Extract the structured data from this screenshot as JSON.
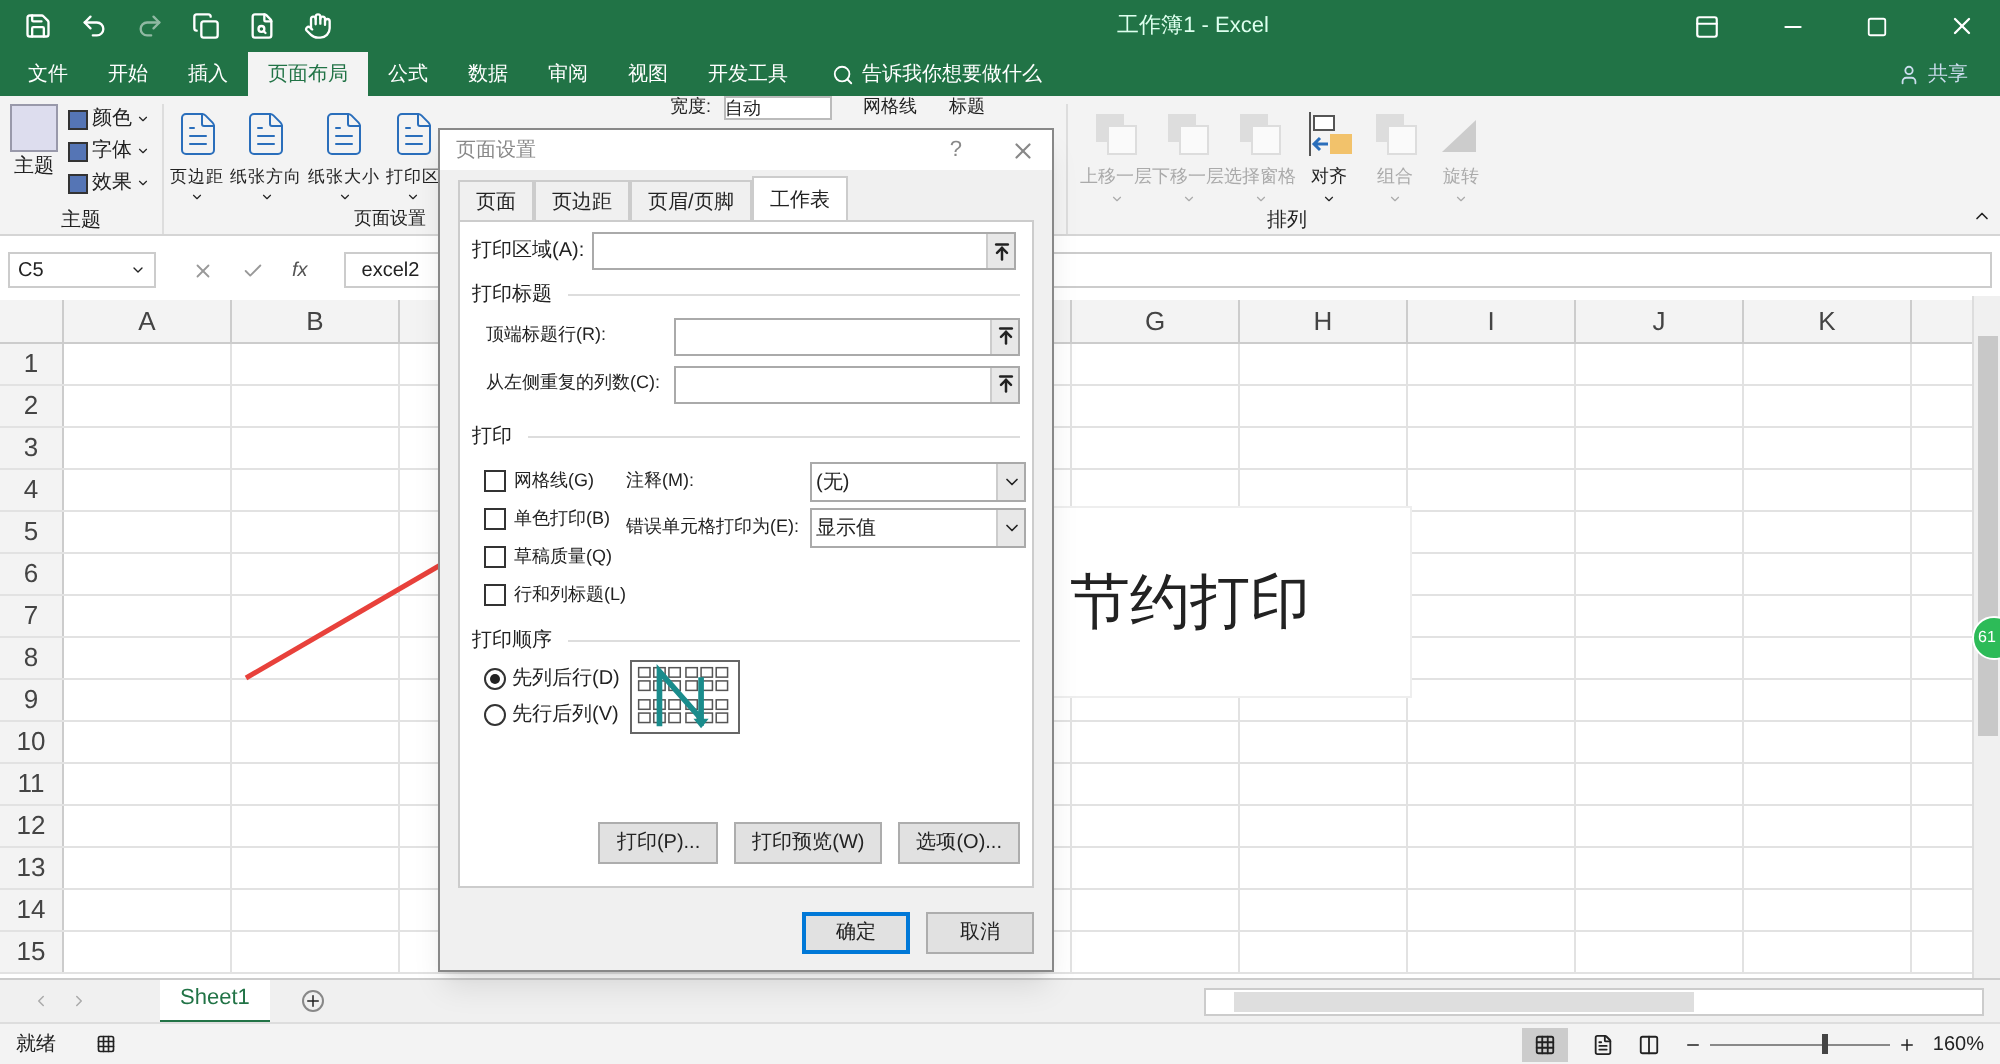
{
  "title_bar": {
    "title": "工作簿1  -  Excel"
  },
  "menu_tabs": [
    {
      "label": "文件",
      "selected": false
    },
    {
      "label": "开始",
      "selected": false
    },
    {
      "label": "插入",
      "selected": false
    },
    {
      "label": "页面布局",
      "selected": true
    },
    {
      "label": "公式",
      "selected": false
    },
    {
      "label": "数据",
      "selected": false
    },
    {
      "label": "审阅",
      "selected": false
    },
    {
      "label": "视图",
      "selected": false
    },
    {
      "label": "开发工具",
      "selected": false
    }
  ],
  "tell_me": "告诉我你想要做什么",
  "share": "共享",
  "ribbon": {
    "theme_group": {
      "label": "主题",
      "main": "主题",
      "items": [
        "颜色",
        "字体",
        "效果"
      ]
    },
    "page_setup_group": {
      "label": "页面设置",
      "items": [
        "页边距",
        "纸张方向",
        "纸张大小",
        "打印区"
      ]
    },
    "scale_group": {
      "width_label": "宽度:",
      "width_value": "自动"
    },
    "sheet_options": [
      "网格线",
      "标题"
    ],
    "arrange_group": {
      "label": "排列",
      "items": [
        {
          "label": "上移一层",
          "disabled": true
        },
        {
          "label": "下移一层",
          "disabled": true
        },
        {
          "label": "选择窗格",
          "disabled": true
        },
        {
          "label": "对齐",
          "disabled": false
        },
        {
          "label": "组合",
          "disabled": true
        },
        {
          "label": "旋转",
          "disabled": true
        }
      ]
    }
  },
  "formula_bar": {
    "name_box": "C5",
    "function_label": "fx",
    "formula": "excel2"
  },
  "columns_left": [
    "A",
    "B"
  ],
  "columns_right": [
    "G",
    "H",
    "I",
    "J",
    "K"
  ],
  "rows": [
    "1",
    "2",
    "3",
    "4",
    "5",
    "6",
    "7",
    "8",
    "9",
    "10",
    "11",
    "12",
    "13",
    "14",
    "15"
  ],
  "text_box": "节约打印",
  "side_badge": "61",
  "sheet_tabs": [
    {
      "label": "Sheet1",
      "selected": true
    }
  ],
  "status_bar": {
    "status": "就绪",
    "zoom": "160%",
    "zoom_level": {
      "level": 0.62
    }
  },
  "dialog": {
    "title": "页面设置",
    "help": "?",
    "tabs": [
      {
        "label": "页面",
        "selected": false
      },
      {
        "label": "页边距",
        "selected": false
      },
      {
        "label": "页眉/页脚",
        "selected": false
      },
      {
        "label": "工作表",
        "selected": true
      }
    ],
    "print_area_label": "打印区域(A):",
    "titles_section": "打印标题",
    "title_fields": [
      "顶端标题行(R):",
      "从左侧重复的列数(C):"
    ],
    "print_section": "打印",
    "checkboxes": [
      {
        "label": "网格线(G)",
        "checked": false
      },
      {
        "label": "单色打印(B)",
        "checked": false
      },
      {
        "label": "草稿质量(Q)",
        "checked": false
      },
      {
        "label": "行和列标题(L)",
        "checked": false
      }
    ],
    "selects": [
      {
        "label": "注释(M):",
        "value": "(无)"
      },
      {
        "label": "错误单元格打印为(E):",
        "value": "显示值"
      }
    ],
    "order_section": "打印顺序",
    "order": [
      {
        "label": "先列后行(D)",
        "selected": true
      },
      {
        "label": "先行后列(V)",
        "selected": false
      }
    ],
    "action_buttons": [
      "打印(P)...",
      "打印预览(W)",
      "选项(O)..."
    ],
    "ok": "确定",
    "cancel": "取消"
  }
}
